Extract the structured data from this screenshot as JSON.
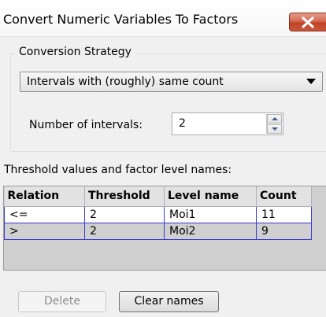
{
  "window": {
    "title": "Convert Numeric Variables To Factors",
    "close_icon": "close-icon"
  },
  "strategy": {
    "legend": "Conversion Strategy",
    "selected": "Intervals with (roughly) same count",
    "intervals_label": "Number of intervals:",
    "intervals_value": "2"
  },
  "thresholds": {
    "label": "Threshold values and factor level names:",
    "columns": [
      "Relation",
      "Threshold",
      "Level name",
      "Count"
    ],
    "rows": [
      [
        "<=",
        "2",
        "Moi1",
        "11"
      ],
      [
        ">",
        "2",
        "Moi2",
        "9"
      ]
    ]
  },
  "buttons": {
    "delete": "Delete",
    "clear": "Clear names"
  },
  "colors": {
    "grid_line": "#3a3acf",
    "close_button": "#c14326"
  }
}
